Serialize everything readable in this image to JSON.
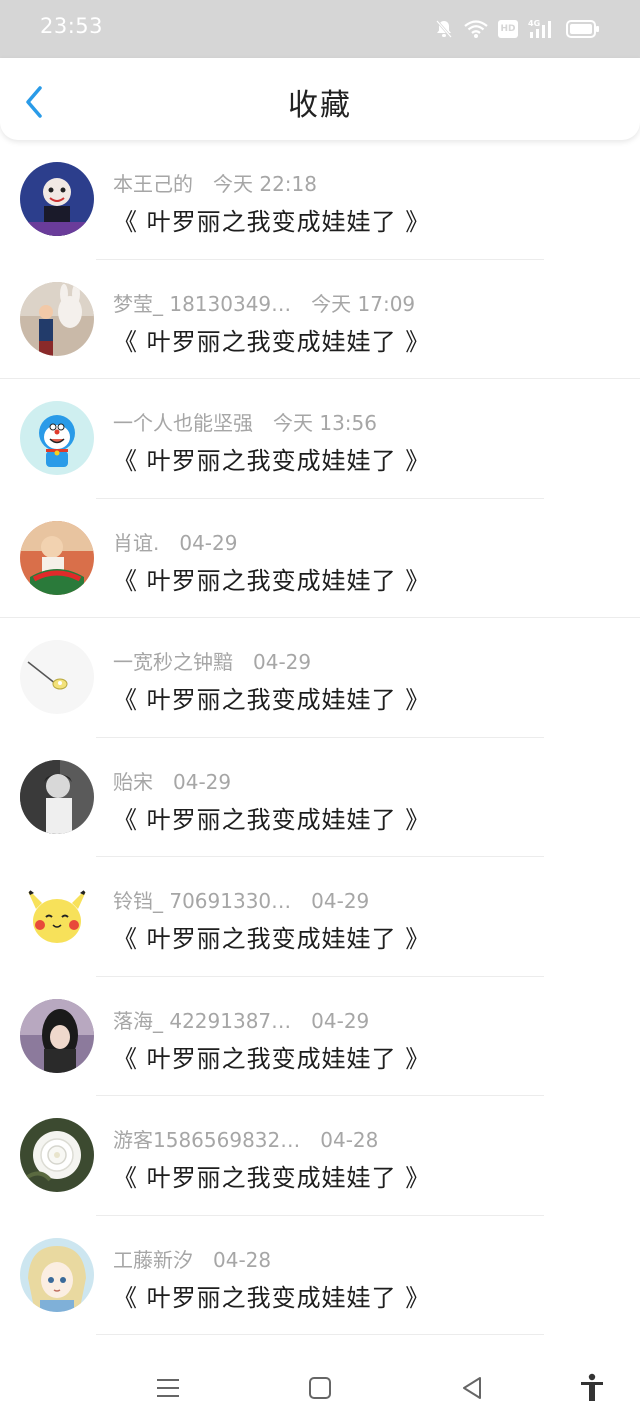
{
  "status_bar": {
    "time": "23:53",
    "hd": "HD",
    "network": "4G"
  },
  "header": {
    "title": "收藏"
  },
  "items": [
    {
      "username": "本王己的",
      "date": "今天 22:18",
      "title": "《 叶罗丽之我变成娃娃了 》",
      "avatar_color": "#2c3e8c"
    },
    {
      "username": "梦莹_ 18130349…",
      "date": "今天 17:09",
      "title": "《 叶罗丽之我变成娃娃了 》",
      "avatar_color": "#c9b9a8"
    },
    {
      "username": "一个人也能坚强",
      "date": "今天 13:56",
      "title": "《 叶罗丽之我变成娃娃了 》",
      "avatar_color": "#cfeff0"
    },
    {
      "username": "肖谊.",
      "date": "04-29",
      "title": "《 叶罗丽之我变成娃娃了 》",
      "avatar_color": "#d96f4a"
    },
    {
      "username": "一宽秒之钟黯",
      "date": "04-29",
      "title": "《 叶罗丽之我变成娃娃了 》",
      "avatar_color": "#f6f6f6"
    },
    {
      "username": "贻宋",
      "date": "04-29",
      "title": "《 叶罗丽之我变成娃娃了 》",
      "avatar_color": "#5a5a5a"
    },
    {
      "username": "铃铛_ 70691330…",
      "date": "04-29",
      "title": "《 叶罗丽之我变成娃娃了 》",
      "avatar_color": "#f7e15a"
    },
    {
      "username": "落海_ 42291387…",
      "date": "04-29",
      "title": "《 叶罗丽之我变成娃娃了 》",
      "avatar_color": "#8c7a9c"
    },
    {
      "username": "游客1586569832…",
      "date": "04-28",
      "title": "《 叶罗丽之我变成娃娃了 》",
      "avatar_color": "#3c4a30"
    },
    {
      "username": "工藤新汐",
      "date": "04-28",
      "title": "《 叶罗丽之我变成娃娃了 》",
      "avatar_color": "#e9d9a0"
    }
  ],
  "colors": {
    "accent": "#2a9be8",
    "status_bar_bg": "#d6d6d6",
    "meta_text": "#a6a6a6"
  },
  "nav": {
    "icons": [
      "menu-icon",
      "home-square-icon",
      "back-triangle-icon",
      "accessibility-icon"
    ]
  }
}
